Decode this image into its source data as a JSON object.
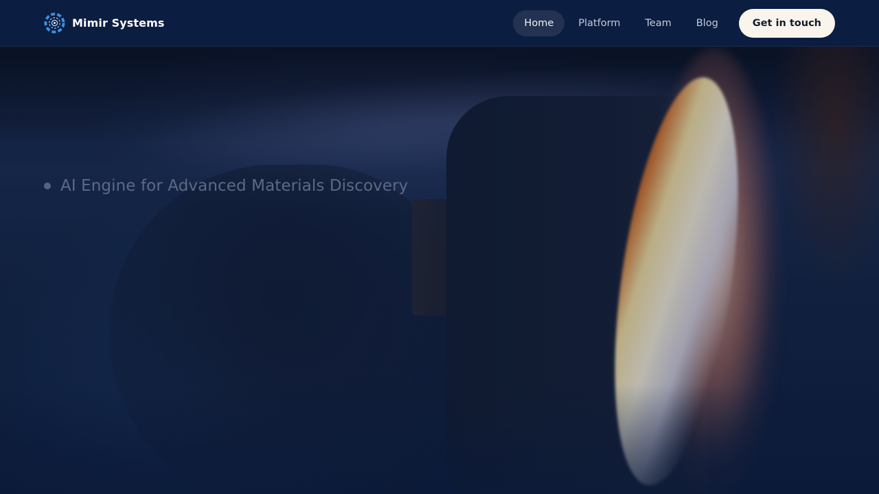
{
  "brand": {
    "name": "Mimir Systems",
    "logo_icon": "aperture-logo-icon",
    "logo_color": "#3f8fe0"
  },
  "nav": {
    "items": [
      {
        "label": "Home",
        "active": true
      },
      {
        "label": "Platform",
        "active": false
      },
      {
        "label": "Team",
        "active": false
      },
      {
        "label": "Blog",
        "active": false
      }
    ],
    "cta_label": "Get in touch"
  },
  "hero": {
    "tagline": "AI Engine for Advanced Materials Discovery",
    "bullet_icon": "dot-icon"
  },
  "colors": {
    "header_bg": "#0b1d40",
    "active_pill": "#233250",
    "cta_bg": "#faf5ec",
    "cta_text": "#141c2f",
    "tagline": "#5c6a85"
  }
}
